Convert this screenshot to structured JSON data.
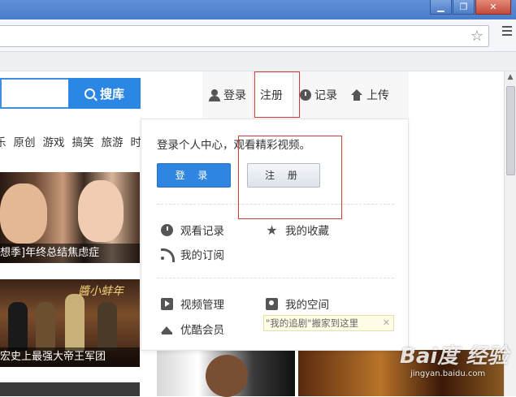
{
  "window": {
    "minimize": "▁",
    "restore": "❐",
    "close": "✕"
  },
  "browser": {
    "star_icon": "star-icon",
    "menu_icon": "menu-icon"
  },
  "search": {
    "button_label": "搜库"
  },
  "userbar": {
    "login": "登录",
    "register": "注册",
    "history": "记录",
    "upload": "上传"
  },
  "nav": {
    "items": [
      "乐",
      "原创",
      "游戏",
      "搞笑",
      "旅游",
      "时"
    ]
  },
  "videos": {
    "caption_1": "想季]年终总结焦虑症",
    "caption_2": "宏史上最强大帝王军团",
    "logo_text": "醬小蚌年"
  },
  "dropdown": {
    "prompt": "登录个人中心，观看精彩视频。",
    "login_button": "登 录",
    "register_button": "注 册",
    "items": {
      "history": "观看记录",
      "favorites": "我的收藏",
      "subscriptions": "我的订阅",
      "video_manage": "视频管理",
      "my_space": "我的空间",
      "vip": "优酷会员"
    },
    "tooltip": "\"我的追剧\"搬家到这里",
    "tooltip_close": "✕"
  },
  "watermark": {
    "main": "Bai度 经验",
    "sub": "jingyan.baidu.com"
  },
  "colors": {
    "accent": "#2c86e3",
    "highlight_box": "#d53a3a"
  }
}
